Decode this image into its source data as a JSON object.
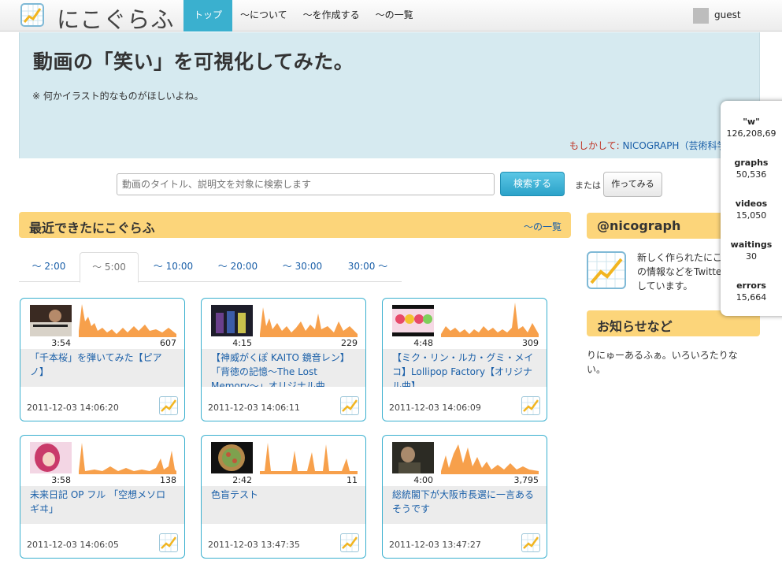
{
  "header": {
    "logo_text": "にこぐらふ",
    "nav": [
      {
        "label": "トップ",
        "active": true
      },
      {
        "label": "〜について"
      },
      {
        "label": "〜を作成する"
      },
      {
        "label": "〜の一覧"
      }
    ],
    "user": "guest"
  },
  "hero": {
    "title": "動画の「笑い」を可視化してみた。",
    "note": "※ 何かイラスト的なものがほしいよね。",
    "maybe_label": "もしかして: ",
    "maybe_link": "NICOGRAPH（芸術科学会）"
  },
  "search": {
    "placeholder": "動画のタイトル、説明文を対象に検索します",
    "button": "検索する",
    "or": "または",
    "make_button": "作ってみる"
  },
  "recent": {
    "heading": "最近できたにこぐらふ",
    "list_link": "〜の一覧",
    "tabs": [
      "〜 2:00",
      "〜 5:00",
      "〜 10:00",
      "〜 20:00",
      "〜 30:00",
      "30:00 〜"
    ],
    "active_tab": 1,
    "cards": [
      {
        "duration": "3:54",
        "count": "607",
        "title": "「千本桜」を弾いてみた【ピアノ】",
        "date": "2011-12-03 14:06:20"
      },
      {
        "duration": "4:15",
        "count": "229",
        "title": "【神威がくぽ KAITO 鏡音レン】「背徳の記憶〜The Lost Memory〜」オリジナル曲",
        "date": "2011-12-03 14:06:11"
      },
      {
        "duration": "4:48",
        "count": "309",
        "title": "【ミク・リン・ルカ・グミ・メイコ】Lollipop Factory【オリジナル曲】",
        "date": "2011-12-03 14:06:09"
      },
      {
        "duration": "3:58",
        "count": "138",
        "title": "未来日記 OP フル 「空想メソロギヰ」",
        "date": "2011-12-03 14:06:05"
      },
      {
        "duration": "2:42",
        "count": "11",
        "title": "色盲テスト",
        "date": "2011-12-03 13:47:35"
      },
      {
        "duration": "4:00",
        "count": "3,795",
        "title": "総統閣下が大阪市長選に一言あるそうです",
        "date": "2011-12-03 13:47:27"
      }
    ]
  },
  "twitter": {
    "heading": "@nicograph",
    "text": "新しく作られたにこぐらふの情報などをTwitterで配信しています。"
  },
  "news": {
    "heading": "お知らせなど",
    "text": "りにゅーあるふぁ。いろいろたりない。"
  },
  "stats": [
    {
      "key": "\"w\"",
      "value": "126,208,69"
    },
    {
      "key": "graphs",
      "value": "50,536"
    },
    {
      "key": "videos",
      "value": "15,050"
    },
    {
      "key": "waitings",
      "value": "30"
    },
    {
      "key": "errors",
      "value": "15,664"
    }
  ],
  "colors": {
    "accent": "#3ab0cf",
    "section": "#fcd57a",
    "graph": "#f7a04b",
    "link": "#1a5fa8"
  }
}
